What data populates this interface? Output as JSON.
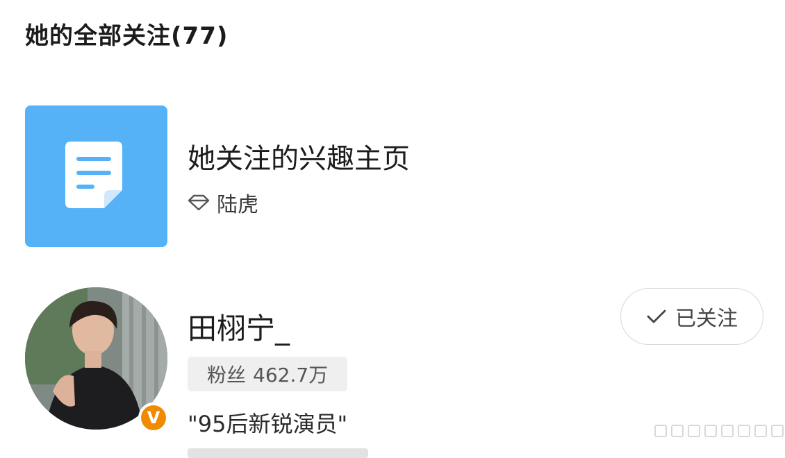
{
  "header": {
    "title": "她的全部关注(77)"
  },
  "interest_page": {
    "icon": "document-icon",
    "title": "她关注的兴趣主页",
    "subtitle_icon": "diamond-icon",
    "subtitle": "陆虎"
  },
  "user": {
    "name": "田栩宁_",
    "fans_label": "粉丝",
    "fans_count": "462.7万",
    "description": "\"95后新锐演员\"",
    "verified_badge": "V",
    "follow_button": "已关注"
  },
  "colors": {
    "tile_blue": "#56b2f7",
    "verified_orange": "#f08a00"
  }
}
